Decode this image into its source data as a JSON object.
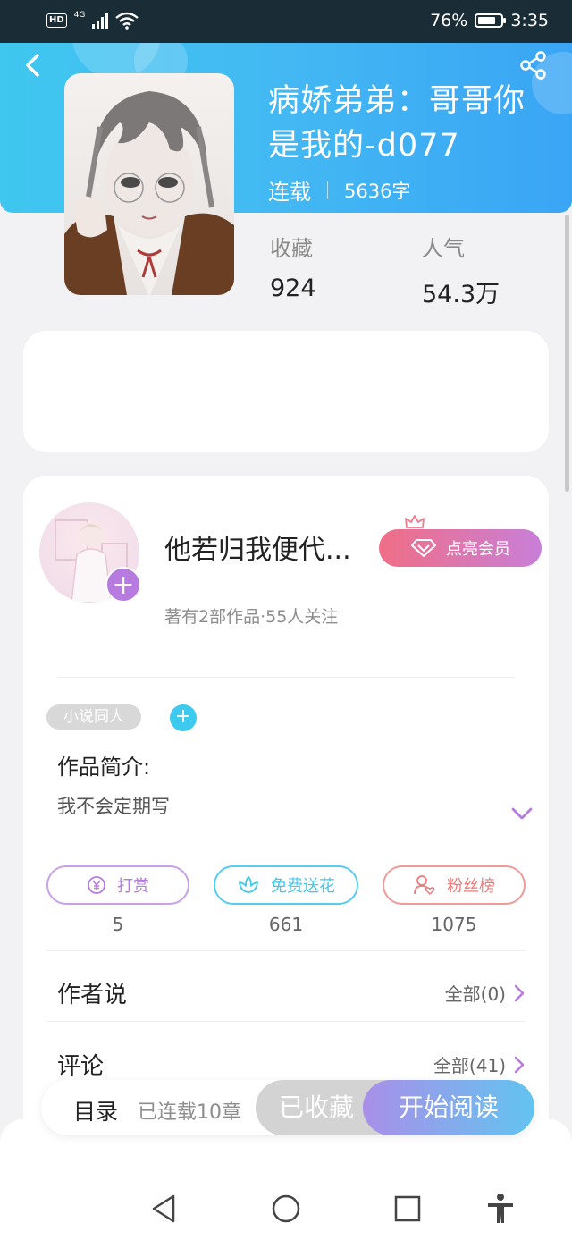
{
  "status_bar": {
    "network_badge": "HD",
    "network_type": "4G",
    "battery": "76%",
    "battery_level": 0.76,
    "time": "3:35"
  },
  "header": {
    "back_icon": "chevron-left-icon",
    "share_icon": "share-icon"
  },
  "book": {
    "title": "病娇弟弟：哥哥你是我的-d077",
    "status": "连载",
    "word_count": "5636字",
    "stats": [
      {
        "label": "收藏",
        "value": "924"
      },
      {
        "label": "人气",
        "value": "54.3万"
      }
    ]
  },
  "author": {
    "name": "他若归我便代...",
    "subtitle": "著有2部作品·55人关注",
    "follow_icon": "plus-icon",
    "vip_button": "点亮会员"
  },
  "details": {
    "tag": "小说同人",
    "intro_label": "作品简介:",
    "intro_text": "我不会定期写"
  },
  "actions": [
    {
      "label": "打赏",
      "count": "5",
      "icon": "yen-icon",
      "color": "#b77be0"
    },
    {
      "label": "免费送花",
      "count": "661",
      "icon": "flower-icon",
      "color": "#3ec9ef"
    },
    {
      "label": "粉丝榜",
      "count": "1075",
      "icon": "user-heart-icon",
      "color": "#ef7a7a"
    }
  ],
  "sections": [
    {
      "title": "作者说",
      "link": "全部(0)"
    },
    {
      "title": "评论",
      "link": "全部(41)"
    }
  ],
  "bottom_bar": {
    "toc_label": "目录",
    "chapters": "已连载10章",
    "collected": "已收藏",
    "read": "开始阅读"
  },
  "colors": {
    "header_gradient_start": "#3fc7ef",
    "header_gradient_end": "#3aa5f5",
    "accent_purple": "#b77be0",
    "accent_blue": "#3ec9ef"
  }
}
